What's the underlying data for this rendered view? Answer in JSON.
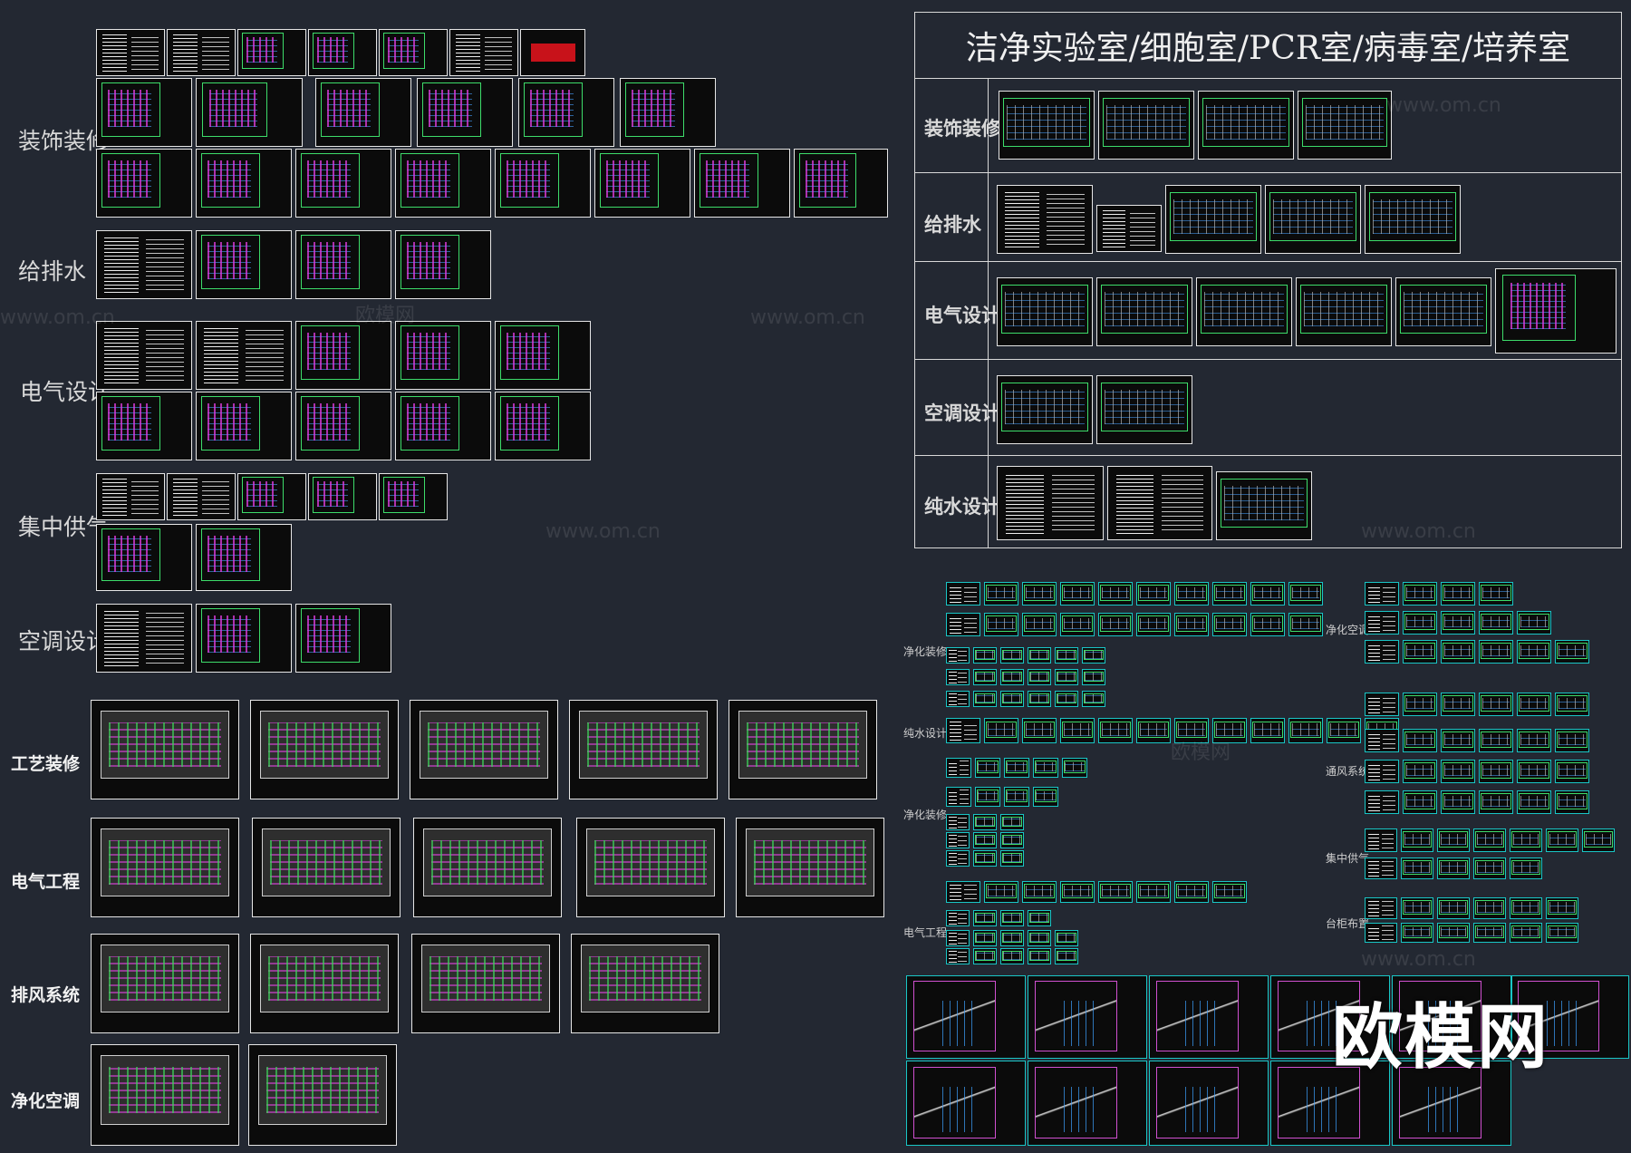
{
  "title": "洁净实验室/细胞室/PCR室/病毒室/培养室",
  "left_labels": [
    "装饰装修",
    "给排水",
    "电气设计",
    "集中供气",
    "空调设计"
  ],
  "left_bold_labels": [
    "工艺装修",
    "电气工程",
    "排风系统",
    "净化空调"
  ],
  "panel_rows": [
    "装饰装修",
    "给排水",
    "电气设计",
    "空调设计",
    "纯水设计"
  ],
  "mid_labels": [
    "净化装修",
    "纯水设计",
    "净化装修",
    "电气工程"
  ],
  "right_labels": [
    "净化空调",
    "通风系统",
    "集中供气",
    "台柜布置"
  ],
  "watermarks": [
    "www.om.cn",
    "欧模网"
  ],
  "logo": "欧模网",
  "colors": {
    "background": "#232832",
    "sheet_border": "#e6e6e6",
    "accent_green": "#3ddc6a",
    "accent_magenta": "#e13ce1",
    "accent_cyan": "#19c6c6"
  }
}
